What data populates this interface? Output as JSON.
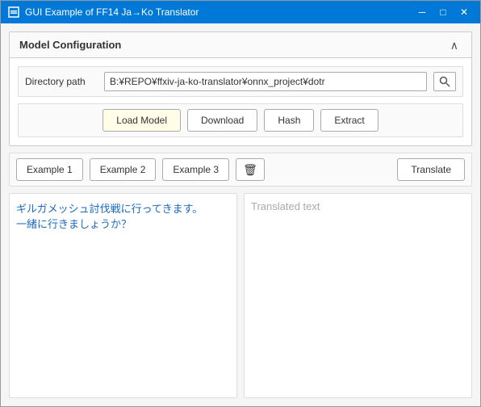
{
  "window": {
    "title": "GUI Example of FF14 Ja→Ko Translator",
    "controls": {
      "minimize": "─",
      "maximize": "□",
      "close": "✕"
    }
  },
  "model_config": {
    "title": "Model Configuration",
    "collapse_icon": "∧",
    "directory": {
      "label": "Directory path",
      "value": "B:¥REPO¥ffxiv-ja-ko-translator¥onnx_project¥dotr",
      "placeholder": "B:¥REPO¥ffxiv-ja-ko-translator¥onnx_project¥dotr",
      "browse_icon": "🔍"
    },
    "actions": {
      "load_model": "Load Model",
      "download": "Download",
      "hash": "Hash",
      "extract": "Extract"
    }
  },
  "examples": {
    "btn1": "Example 1",
    "btn2": "Example 2",
    "btn3": "Example 3",
    "trash_icon": "🗑",
    "translate": "Translate"
  },
  "text_areas": {
    "source": "ギルガメッシュ討伐戦に行ってきます。\n一緒に行きましょうか？",
    "translated_placeholder": "Translated text"
  }
}
